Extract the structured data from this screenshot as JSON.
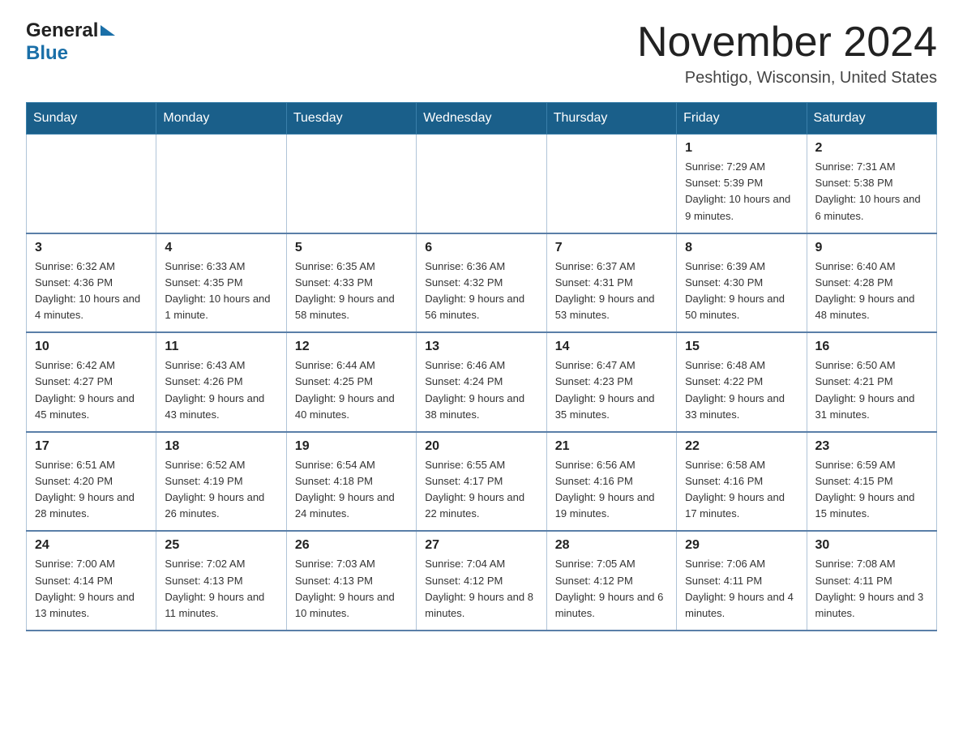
{
  "header": {
    "logo_general": "General",
    "logo_blue": "Blue",
    "title": "November 2024",
    "subtitle": "Peshtigo, Wisconsin, United States"
  },
  "days_of_week": [
    "Sunday",
    "Monday",
    "Tuesday",
    "Wednesday",
    "Thursday",
    "Friday",
    "Saturday"
  ],
  "weeks": [
    [
      {
        "day": "",
        "info": ""
      },
      {
        "day": "",
        "info": ""
      },
      {
        "day": "",
        "info": ""
      },
      {
        "day": "",
        "info": ""
      },
      {
        "day": "",
        "info": ""
      },
      {
        "day": "1",
        "info": "Sunrise: 7:29 AM\nSunset: 5:39 PM\nDaylight: 10 hours and 9 minutes."
      },
      {
        "day": "2",
        "info": "Sunrise: 7:31 AM\nSunset: 5:38 PM\nDaylight: 10 hours and 6 minutes."
      }
    ],
    [
      {
        "day": "3",
        "info": "Sunrise: 6:32 AM\nSunset: 4:36 PM\nDaylight: 10 hours and 4 minutes."
      },
      {
        "day": "4",
        "info": "Sunrise: 6:33 AM\nSunset: 4:35 PM\nDaylight: 10 hours and 1 minute."
      },
      {
        "day": "5",
        "info": "Sunrise: 6:35 AM\nSunset: 4:33 PM\nDaylight: 9 hours and 58 minutes."
      },
      {
        "day": "6",
        "info": "Sunrise: 6:36 AM\nSunset: 4:32 PM\nDaylight: 9 hours and 56 minutes."
      },
      {
        "day": "7",
        "info": "Sunrise: 6:37 AM\nSunset: 4:31 PM\nDaylight: 9 hours and 53 minutes."
      },
      {
        "day": "8",
        "info": "Sunrise: 6:39 AM\nSunset: 4:30 PM\nDaylight: 9 hours and 50 minutes."
      },
      {
        "day": "9",
        "info": "Sunrise: 6:40 AM\nSunset: 4:28 PM\nDaylight: 9 hours and 48 minutes."
      }
    ],
    [
      {
        "day": "10",
        "info": "Sunrise: 6:42 AM\nSunset: 4:27 PM\nDaylight: 9 hours and 45 minutes."
      },
      {
        "day": "11",
        "info": "Sunrise: 6:43 AM\nSunset: 4:26 PM\nDaylight: 9 hours and 43 minutes."
      },
      {
        "day": "12",
        "info": "Sunrise: 6:44 AM\nSunset: 4:25 PM\nDaylight: 9 hours and 40 minutes."
      },
      {
        "day": "13",
        "info": "Sunrise: 6:46 AM\nSunset: 4:24 PM\nDaylight: 9 hours and 38 minutes."
      },
      {
        "day": "14",
        "info": "Sunrise: 6:47 AM\nSunset: 4:23 PM\nDaylight: 9 hours and 35 minutes."
      },
      {
        "day": "15",
        "info": "Sunrise: 6:48 AM\nSunset: 4:22 PM\nDaylight: 9 hours and 33 minutes."
      },
      {
        "day": "16",
        "info": "Sunrise: 6:50 AM\nSunset: 4:21 PM\nDaylight: 9 hours and 31 minutes."
      }
    ],
    [
      {
        "day": "17",
        "info": "Sunrise: 6:51 AM\nSunset: 4:20 PM\nDaylight: 9 hours and 28 minutes."
      },
      {
        "day": "18",
        "info": "Sunrise: 6:52 AM\nSunset: 4:19 PM\nDaylight: 9 hours and 26 minutes."
      },
      {
        "day": "19",
        "info": "Sunrise: 6:54 AM\nSunset: 4:18 PM\nDaylight: 9 hours and 24 minutes."
      },
      {
        "day": "20",
        "info": "Sunrise: 6:55 AM\nSunset: 4:17 PM\nDaylight: 9 hours and 22 minutes."
      },
      {
        "day": "21",
        "info": "Sunrise: 6:56 AM\nSunset: 4:16 PM\nDaylight: 9 hours and 19 minutes."
      },
      {
        "day": "22",
        "info": "Sunrise: 6:58 AM\nSunset: 4:16 PM\nDaylight: 9 hours and 17 minutes."
      },
      {
        "day": "23",
        "info": "Sunrise: 6:59 AM\nSunset: 4:15 PM\nDaylight: 9 hours and 15 minutes."
      }
    ],
    [
      {
        "day": "24",
        "info": "Sunrise: 7:00 AM\nSunset: 4:14 PM\nDaylight: 9 hours and 13 minutes."
      },
      {
        "day": "25",
        "info": "Sunrise: 7:02 AM\nSunset: 4:13 PM\nDaylight: 9 hours and 11 minutes."
      },
      {
        "day": "26",
        "info": "Sunrise: 7:03 AM\nSunset: 4:13 PM\nDaylight: 9 hours and 10 minutes."
      },
      {
        "day": "27",
        "info": "Sunrise: 7:04 AM\nSunset: 4:12 PM\nDaylight: 9 hours and 8 minutes."
      },
      {
        "day": "28",
        "info": "Sunrise: 7:05 AM\nSunset: 4:12 PM\nDaylight: 9 hours and 6 minutes."
      },
      {
        "day": "29",
        "info": "Sunrise: 7:06 AM\nSunset: 4:11 PM\nDaylight: 9 hours and 4 minutes."
      },
      {
        "day": "30",
        "info": "Sunrise: 7:08 AM\nSunset: 4:11 PM\nDaylight: 9 hours and 3 minutes."
      }
    ]
  ]
}
